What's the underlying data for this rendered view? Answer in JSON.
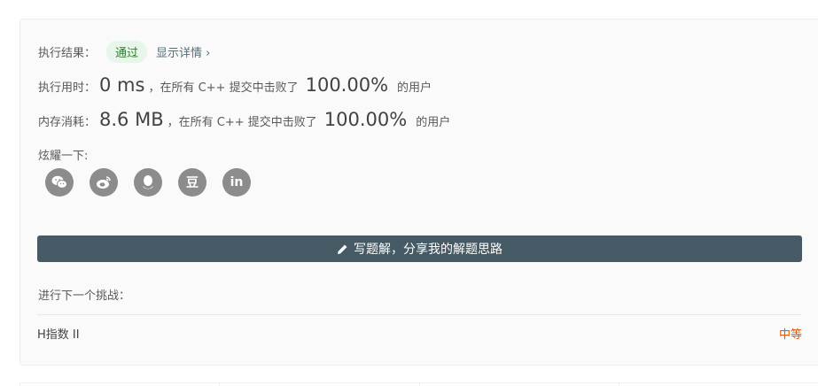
{
  "result": {
    "label": "执行结果：",
    "status": "通过",
    "detail_link": "显示详情 ›"
  },
  "runtime": {
    "label": "执行用时：",
    "value": "0 ms",
    "mid_text": "，在所有 C++ 提交中击败了",
    "percent": "100.00%",
    "suffix": "的用户"
  },
  "memory": {
    "label": "内存消耗：",
    "value": "8.6 MB",
    "mid_text": "，在所有 C++ 提交中击败了",
    "percent": "100.00%",
    "suffix": "的用户"
  },
  "share": {
    "label": "炫耀一下:",
    "icons": [
      "wechat-icon",
      "weibo-icon",
      "qq-icon",
      "douban-icon",
      "linkedin-icon"
    ],
    "douban_glyph": "豆",
    "linkedin_glyph": "in"
  },
  "write_button": "写题解，分享我的解题思路",
  "next": {
    "label": "进行下一个挑战：",
    "problem_title": "H指数 II",
    "difficulty": "中等"
  },
  "colors": {
    "success_bg": "#e8f5e9",
    "success_text": "#2e7d32",
    "button_bg": "#455a64",
    "difficulty_medium": "#e65100"
  }
}
